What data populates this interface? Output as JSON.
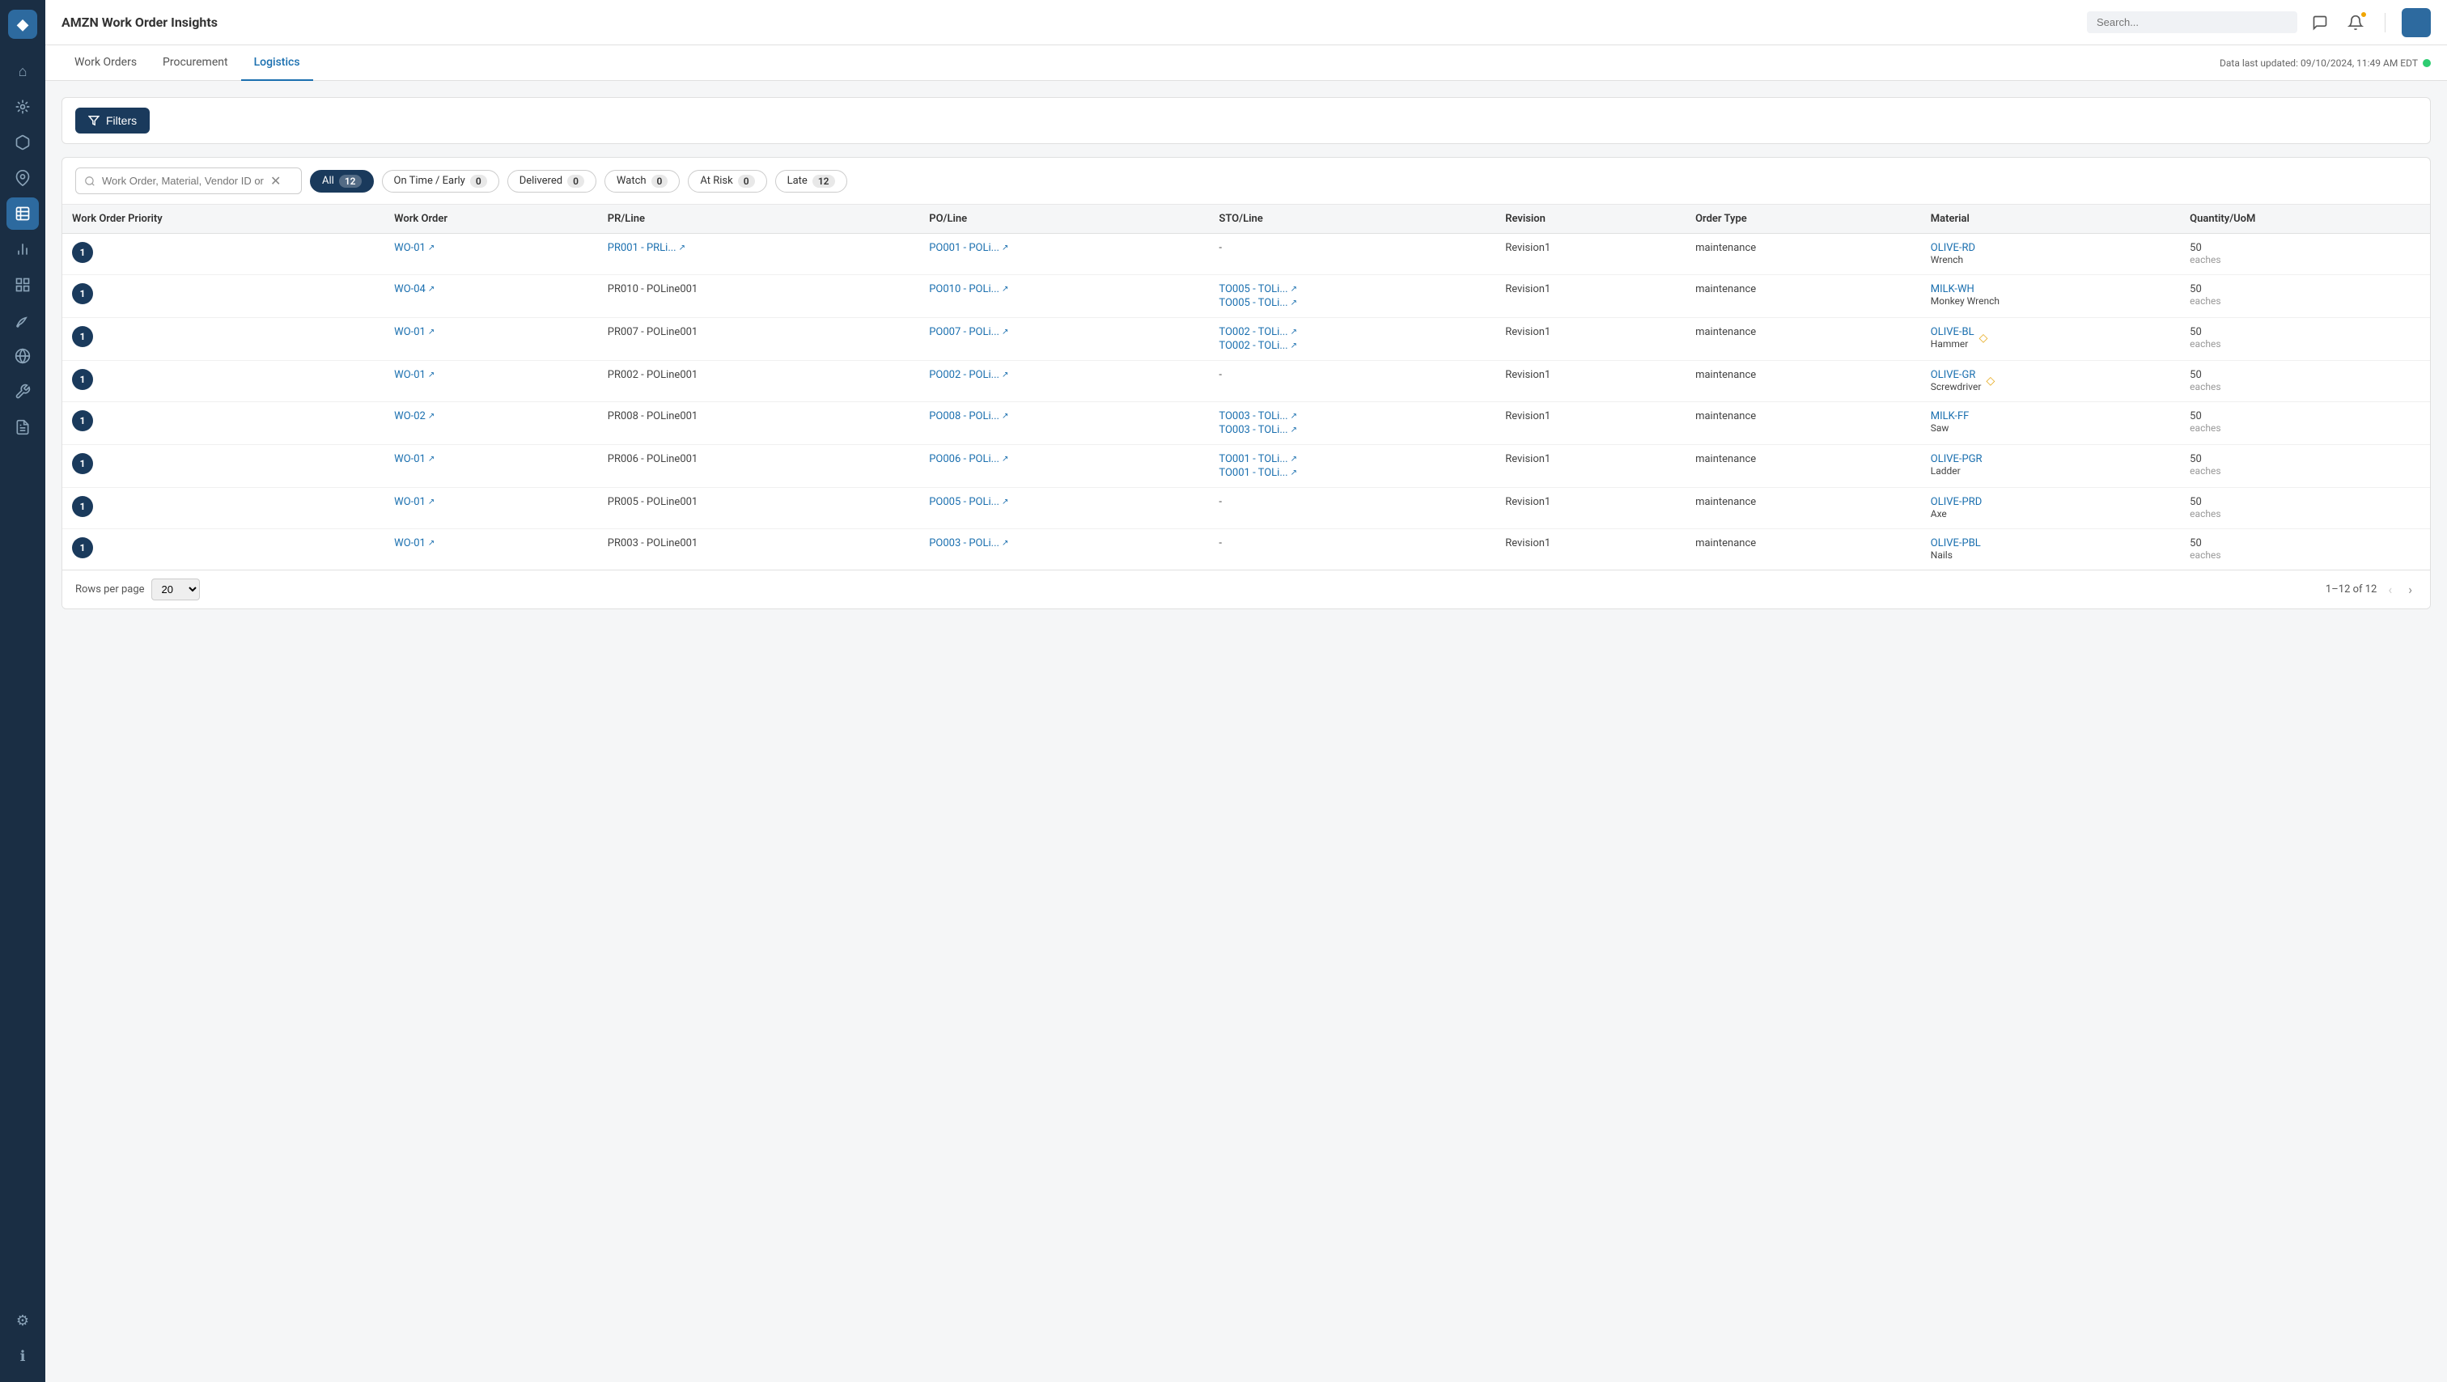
{
  "app": {
    "logo": "◆",
    "brand": "AMZN",
    "title": "Work Order Insights"
  },
  "topnav": {
    "chat_icon": "💬",
    "bell_icon": "🔔",
    "search_placeholder": "Search..."
  },
  "data_updated": {
    "label": "Data last updated: 09/10/2024, 11:49 AM EDT"
  },
  "tabs": [
    {
      "id": "work-orders",
      "label": "Work Orders"
    },
    {
      "id": "procurement",
      "label": "Procurement"
    },
    {
      "id": "logistics",
      "label": "Logistics",
      "active": true
    }
  ],
  "filters_button": "Filters",
  "search": {
    "placeholder": "Work Order, Material, Vendor ID or Name"
  },
  "filter_chips": [
    {
      "id": "all",
      "label": "All",
      "count": "12",
      "active": true
    },
    {
      "id": "on-time-early",
      "label": "On Time / Early",
      "count": "0",
      "active": false
    },
    {
      "id": "delivered",
      "label": "Delivered",
      "count": "0",
      "active": false
    },
    {
      "id": "watch",
      "label": "Watch",
      "count": "0",
      "active": false
    },
    {
      "id": "at-risk",
      "label": "At Risk",
      "count": "0",
      "active": false
    },
    {
      "id": "late",
      "label": "Late",
      "count": "12",
      "active": false
    }
  ],
  "table": {
    "columns": [
      "Work Order Priority",
      "Work Order",
      "PR/Line",
      "PO/Line",
      "STO/Line",
      "Revision",
      "Order Type",
      "Material",
      "Quantity/UoM"
    ],
    "rows": [
      {
        "priority": "1",
        "work_order": "WO-01",
        "pr_line": "PR001 - PRLi...",
        "po_line": "PO001 - POLi...",
        "sto_line": "-",
        "revision": "Revision1",
        "order_type": "maintenance",
        "material_code": "OLIVE-RD",
        "material_name": "Wrench",
        "quantity": "50",
        "uom": "eaches",
        "warn": false,
        "sto_links": []
      },
      {
        "priority": "1",
        "work_order": "WO-04",
        "pr_line": "PR010 - POLine001",
        "po_line": "PO010 - POLi...",
        "sto_line": "",
        "revision": "Revision1",
        "order_type": "maintenance",
        "material_code": "MILK-WH",
        "material_name": "Monkey Wrench",
        "quantity": "50",
        "uom": "eaches",
        "warn": false,
        "sto_links": [
          "TO005 - TOLi...",
          "TO005 - TOLi..."
        ]
      },
      {
        "priority": "1",
        "work_order": "WO-01",
        "pr_line": "PR007 - POLine001",
        "po_line": "PO007 - POLi...",
        "sto_line": "",
        "revision": "Revision1",
        "order_type": "maintenance",
        "material_code": "OLIVE-BL",
        "material_name": "Hammer",
        "quantity": "50",
        "uom": "eaches",
        "warn": true,
        "sto_links": [
          "TO002 - TOLi...",
          "TO002 - TOLi..."
        ]
      },
      {
        "priority": "1",
        "work_order": "WO-01",
        "pr_line": "PR002 - POLine001",
        "po_line": "PO002 - POLi...",
        "sto_line": "-",
        "revision": "Revision1",
        "order_type": "maintenance",
        "material_code": "OLIVE-GR",
        "material_name": "Screwdriver",
        "quantity": "50",
        "uom": "eaches",
        "warn": true,
        "sto_links": []
      },
      {
        "priority": "1",
        "work_order": "WO-02",
        "pr_line": "PR008 - POLine001",
        "po_line": "PO008 - POLi...",
        "sto_line": "",
        "revision": "Revision1",
        "order_type": "maintenance",
        "material_code": "MILK-FF",
        "material_name": "Saw",
        "quantity": "50",
        "uom": "eaches",
        "warn": false,
        "sto_links": [
          "TO003 - TOLi...",
          "TO003 - TOLi..."
        ]
      },
      {
        "priority": "1",
        "work_order": "WO-01",
        "pr_line": "PR006 - POLine001",
        "po_line": "PO006 - POLi...",
        "sto_line": "",
        "revision": "Revision1",
        "order_type": "maintenance",
        "material_code": "OLIVE-PGR",
        "material_name": "Ladder",
        "quantity": "50",
        "uom": "eaches",
        "warn": false,
        "sto_links": [
          "TO001 - TOLi...",
          "TO001 - TOLi..."
        ]
      },
      {
        "priority": "1",
        "work_order": "WO-01",
        "pr_line": "PR005 - POLine001",
        "po_line": "PO005 - POLi...",
        "sto_line": "-",
        "revision": "Revision1",
        "order_type": "maintenance",
        "material_code": "OLIVE-PRD",
        "material_name": "Axe",
        "quantity": "50",
        "uom": "eaches",
        "warn": false,
        "sto_links": []
      },
      {
        "priority": "1",
        "work_order": "WO-01",
        "pr_line": "PR003 - POLine001",
        "po_line": "PO003 - POLi...",
        "sto_line": "-",
        "revision": "Revision1",
        "order_type": "maintenance",
        "material_code": "OLIVE-PBL",
        "material_name": "Nails",
        "quantity": "50",
        "uom": "eaches",
        "warn": false,
        "sto_links": []
      }
    ]
  },
  "pagination": {
    "rows_per_page_label": "Rows per page",
    "rows_per_page_value": "20",
    "page_info": "1–12 of 12"
  },
  "sidebar_items": [
    {
      "id": "home",
      "icon": "⌂",
      "active": false
    },
    {
      "id": "analytics",
      "icon": "◈",
      "active": false
    },
    {
      "id": "box",
      "icon": "⬡",
      "active": false
    },
    {
      "id": "location",
      "icon": "◎",
      "active": false
    },
    {
      "id": "table",
      "icon": "⊞",
      "active": true
    },
    {
      "id": "chart",
      "icon": "▦",
      "active": false
    },
    {
      "id": "grid",
      "icon": "⊟",
      "active": false
    },
    {
      "id": "leaf",
      "icon": "❧",
      "active": false
    },
    {
      "id": "settings2",
      "icon": "⊙",
      "active": false
    },
    {
      "id": "plugin",
      "icon": "⊗",
      "active": false
    },
    {
      "id": "report",
      "icon": "▤",
      "active": false
    }
  ],
  "sidebar_bottom": [
    {
      "id": "settings",
      "icon": "⚙"
    },
    {
      "id": "info",
      "icon": "ℹ"
    }
  ]
}
